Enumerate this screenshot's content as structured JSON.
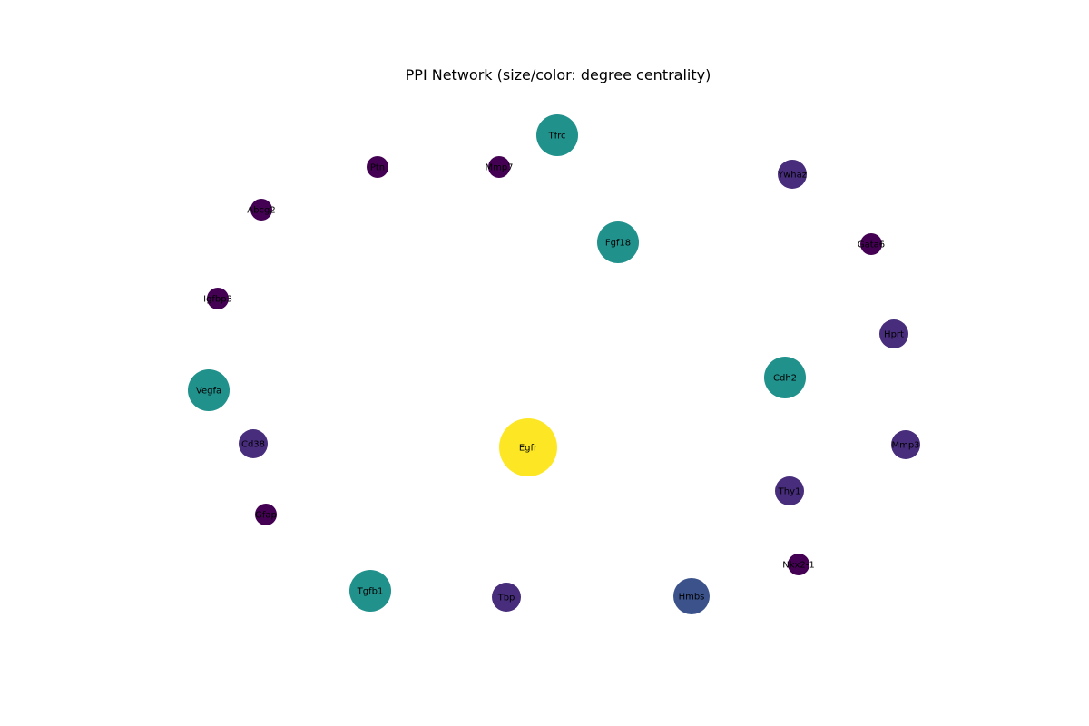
{
  "title": "PPI Network (size/color: degree centrality)",
  "colormap": {
    "low": "#440154",
    "lowmid": "#472d7b",
    "mid": "#3b528b",
    "midhigh": "#21918c",
    "high": "#fde725"
  },
  "nodes": [
    {
      "label": "Tfrc",
      "centrality": 0.4
    },
    {
      "label": "Mmp7",
      "centrality": 0.05
    },
    {
      "label": "Ptn",
      "centrality": 0.05
    },
    {
      "label": "Ywhaz",
      "centrality": 0.15
    },
    {
      "label": "Abcg2",
      "centrality": 0.05
    },
    {
      "label": "Fgf18",
      "centrality": 0.4
    },
    {
      "label": "Gata6",
      "centrality": 0.05
    },
    {
      "label": "Igfbp3",
      "centrality": 0.05
    },
    {
      "label": "Hprt",
      "centrality": 0.15
    },
    {
      "label": "Cdh2",
      "centrality": 0.4
    },
    {
      "label": "Vegfa",
      "centrality": 0.4
    },
    {
      "label": "Cd38",
      "centrality": 0.15
    },
    {
      "label": "Egfr",
      "centrality": 1.0
    },
    {
      "label": "Mmp3",
      "centrality": 0.15
    },
    {
      "label": "Thy1",
      "centrality": 0.15
    },
    {
      "label": "Gfap",
      "centrality": 0.05
    },
    {
      "label": "Nkx2-1",
      "centrality": 0.05
    },
    {
      "label": "Tgfb1",
      "centrality": 0.4
    },
    {
      "label": "Tbp",
      "centrality": 0.15
    },
    {
      "label": "Hmbs",
      "centrality": 0.25
    }
  ]
}
